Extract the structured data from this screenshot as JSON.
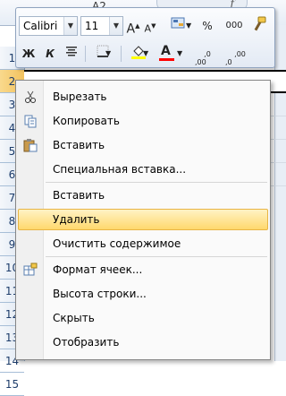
{
  "name_box": {
    "value": "A2"
  },
  "formula_bar": {
    "fx_label": "f"
  },
  "rows": [
    "1",
    "2",
    "3",
    "4",
    "5",
    "6",
    "7",
    "8",
    "9",
    "10",
    "11",
    "12",
    "13",
    "14",
    "15"
  ],
  "selected_row": "2",
  "mini_toolbar": {
    "font_name": "Calibri",
    "font_size": "11",
    "grow_font": "A",
    "shrink_font": "A",
    "percent": "%",
    "thousands": "000",
    "bold": "Ж",
    "italic": "К",
    "fill_color": "#ffff00",
    "font_color": "#ff0000",
    "font_color_letter": "A",
    "increase_decimal": ",0\n,00",
    "decrease_decimal": ",00\n,0"
  },
  "context_menu": {
    "items": [
      {
        "label": "Вырезать",
        "icon": "scissors-icon"
      },
      {
        "label": "Копировать",
        "icon": "copy-icon"
      },
      {
        "label": "Вставить",
        "icon": "paste-icon"
      },
      {
        "label": "Специальная вставка..."
      },
      {
        "label": "Вставить"
      },
      {
        "label": "Удалить",
        "highlighted": true
      },
      {
        "label": "Очистить содержимое"
      },
      {
        "label": "Формат ячеек...",
        "icon": "format-cells-icon"
      },
      {
        "label": "Высота строки..."
      },
      {
        "label": "Скрыть"
      },
      {
        "label": "Отобразить"
      }
    ]
  },
  "colors": {
    "highlight": "#ffd86d",
    "selected_row_header": "#f2c25e",
    "accent": "#1e3d6b"
  }
}
